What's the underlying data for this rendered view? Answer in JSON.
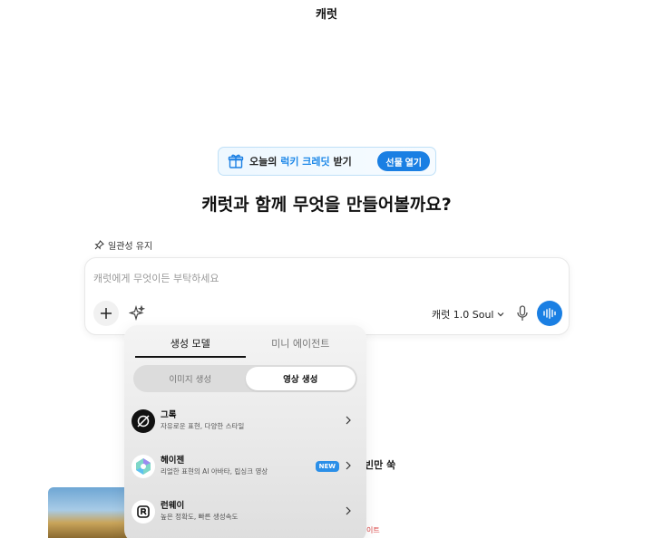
{
  "app": {
    "title": "캐럿"
  },
  "promo": {
    "prefix": "오늘의 ",
    "highlight": "럭키 크레딧",
    "suffix": " 받기",
    "button": "선물 열기"
  },
  "hero": {
    "title": "캐럿과 함께 무엇을 만들어볼까요?"
  },
  "consistency": {
    "label": "일관성 유지"
  },
  "composer": {
    "placeholder": "캐럿에게 무엇이든 부탁하세요",
    "model_label": "캐럿 1.0 Soul"
  },
  "popup": {
    "tabs": [
      {
        "label": "생성 모델",
        "active": true
      },
      {
        "label": "미니 에이전트",
        "active": false
      }
    ],
    "segments": [
      {
        "label": "이미지 생성",
        "active": false
      },
      {
        "label": "영상 생성",
        "active": true
      }
    ],
    "models": [
      {
        "name": "그록",
        "desc": "자유로운 표현, 다양한 스타일",
        "icon": "grok-icon",
        "badge": ""
      },
      {
        "name": "헤이젠",
        "desc": "리얼한 표현의 AI 아바타, 립싱크 영상",
        "icon": "heygen-icon",
        "badge": "NEW"
      },
      {
        "name": "런웨이",
        "desc": "높은 정확도, 빠른 생성속도",
        "icon": "runway-icon",
        "badge": ""
      }
    ]
  },
  "background": {
    "partial_text": "빈만 쑥",
    "red_text": "이트"
  },
  "colors": {
    "accent": "#1a7fe3",
    "badge": "#2b8fe8"
  }
}
